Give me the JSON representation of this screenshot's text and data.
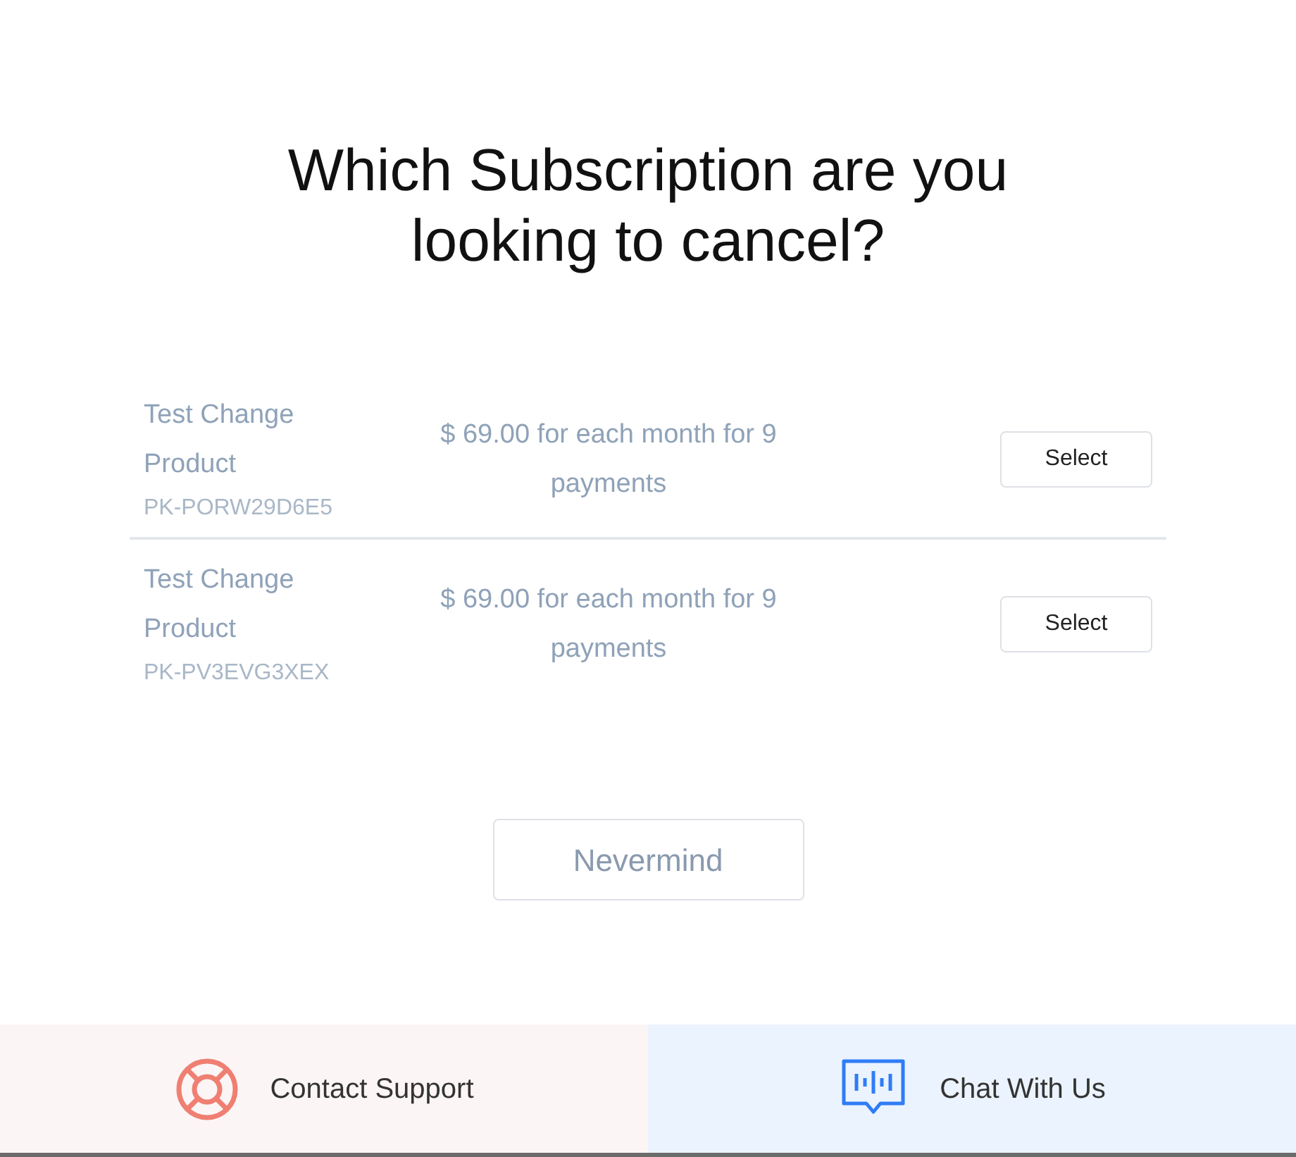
{
  "title": "Which Subscription are you looking to cancel?",
  "subscriptions": [
    {
      "name": "Test Change Product",
      "price": "$ 69.00 for each month for 9 payments",
      "code": "PK-PORW29D6E5",
      "action": "Select"
    },
    {
      "name": "Test Change Product",
      "price": "$ 69.00 for each month for 9 payments",
      "code": "PK-PV3EVG3XEX",
      "action": "Select"
    }
  ],
  "cancel_button": "Nevermind",
  "footer": [
    {
      "kind": "support",
      "label": "Contact Support"
    },
    {
      "kind": "chat",
      "label": "Chat With Us"
    }
  ]
}
